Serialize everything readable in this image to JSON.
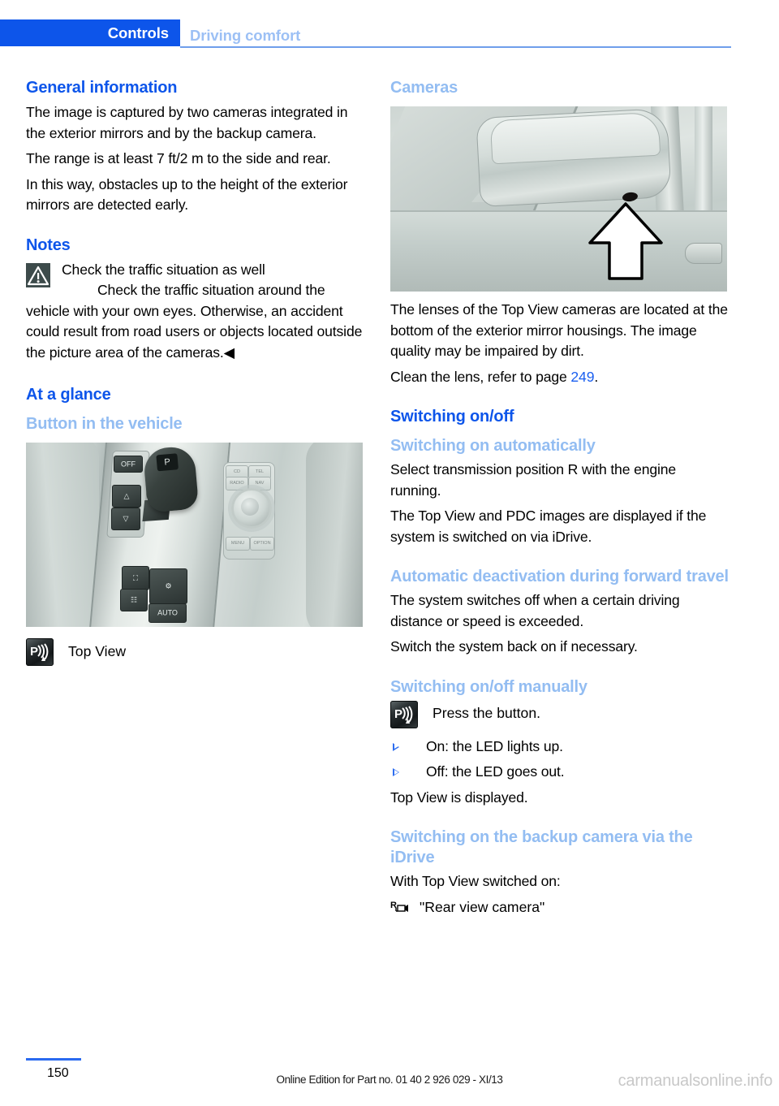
{
  "header": {
    "active_tab": "Controls",
    "secondary_tab": "Driving comfort"
  },
  "colors": {
    "accent_blue": "#0d55ea",
    "subheading_blue": "#93bdf2",
    "link_blue": "#1a5ff0",
    "warning_icon_bg": "#3d4b4b"
  },
  "left_column": {
    "general_information": {
      "heading": "General information",
      "paragraphs": [
        "The image is captured by two cameras integrated in the exterior mirrors and by the backup camera.",
        "The range is at least 7 ft/2 m to the side and rear.",
        "In this way, obstacles up to the height of the exterior mirrors are detected early."
      ]
    },
    "notes": {
      "heading": "Notes",
      "warning_title": "Check the traffic situation as well",
      "warning_body": "Check the traffic situation around the vehicle with your own eyes. Otherwise, an accident could result from road users or objects located outside the picture area of the cameras.◀"
    },
    "at_a_glance": {
      "heading": "At a glance",
      "subheading": "Button in the vehicle",
      "figure_alt": "Center console with gear selector and iDrive controller",
      "caption": "Top View"
    }
  },
  "right_column": {
    "cameras": {
      "heading": "Cameras",
      "figure_alt": "Exterior mirror housing with arrow pointing to camera lens",
      "paragraphs": [
        "The lenses of the Top View cameras are located at the bottom of the exterior mirror housings. The image quality may be impaired by dirt."
      ],
      "clean_lens_prefix": "Clean the lens, refer to page ",
      "clean_lens_page": "249",
      "clean_lens_suffix": "."
    },
    "switching_on_off": {
      "heading": "Switching on/off",
      "auto_on": {
        "subheading": "Switching on automatically",
        "paragraphs": [
          "Select transmission position R with the engine running.",
          "The Top View and PDC images are displayed if the system is switched on via iDrive."
        ]
      },
      "auto_deactivation": {
        "subheading": "Automatic deactivation during forward travel",
        "paragraphs": [
          "The system switches off when a certain driving distance or speed is exceeded.",
          "Switch the system back on if necessary."
        ]
      },
      "manual": {
        "subheading": "Switching on/off manually",
        "press_button_text": "Press the button.",
        "bullets": [
          "On: the LED lights up.",
          "Off: the LED goes out."
        ],
        "trailing_text": "Top View is displayed."
      },
      "backup_via_idrive": {
        "subheading": "Switching on the backup camera via the iDrive",
        "paragraph": "With Top View switched on:",
        "menu_item": "\"Rear view camera\""
      }
    }
  },
  "footer": {
    "page_number": "150",
    "edition_text": "Online Edition for Part no. 01 40 2 926 029 - XI/13",
    "watermark": "carmanualsonline.info"
  }
}
